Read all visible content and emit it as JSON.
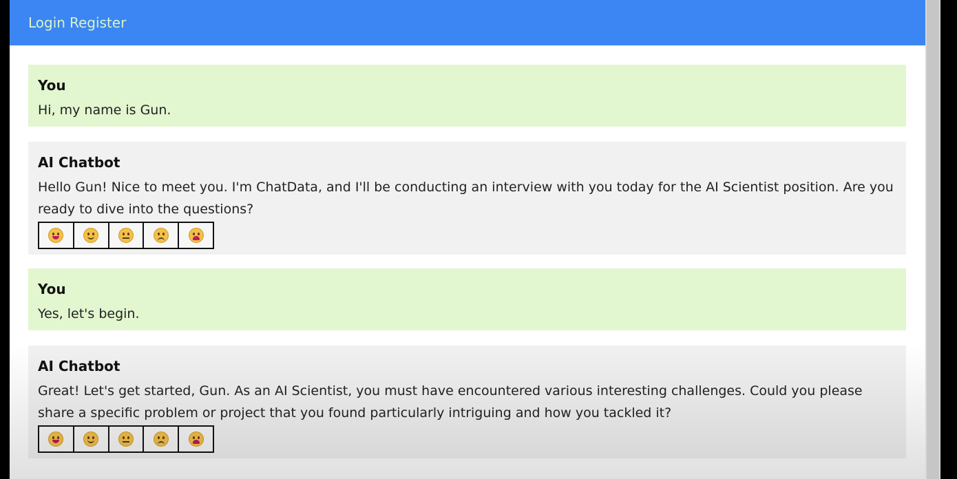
{
  "nav": {
    "login": "Login",
    "register": "Register"
  },
  "messages": [
    {
      "role": "user",
      "sender": "You",
      "text": "Hi, my name is Gun."
    },
    {
      "role": "bot",
      "sender": "AI Chatbot",
      "text": "Hello Gun! Nice to meet you. I'm ChatData, and I'll be conducting an interview with you today for the AI Scientist position. Are you ready to dive into the questions?"
    },
    {
      "role": "user",
      "sender": "You",
      "text": "Yes, let's begin."
    },
    {
      "role": "bot",
      "sender": "AI Chatbot",
      "text": "Great! Let's get started, Gun. As an AI Scientist, you must have encountered various interesting challenges. Could you please share a specific problem or project that you found particularly intriguing and how you tackled it?"
    }
  ],
  "ratings": [
    "grinning-face",
    "smiling-face",
    "neutral-face",
    "frowning-face",
    "crying-face"
  ],
  "colors": {
    "header": "#3b86f2",
    "header_text": "#dbf3c8",
    "user_bubble": "#e2f6cf",
    "bot_bubble": "#f1f1f1"
  }
}
